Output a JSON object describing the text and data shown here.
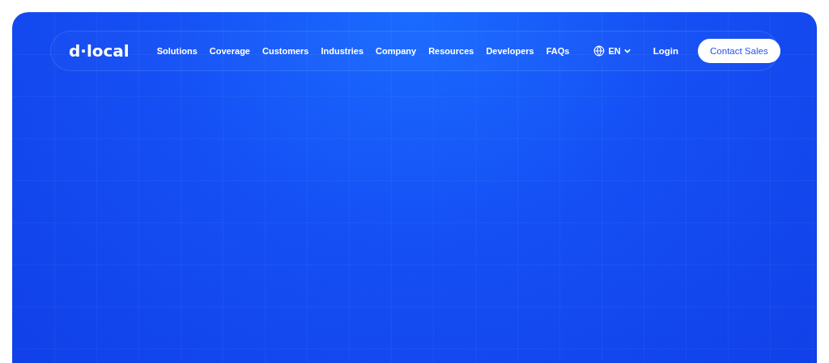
{
  "logo": "d·local",
  "nav": [
    "Solutions",
    "Coverage",
    "Customers",
    "Industries",
    "Company",
    "Resources",
    "Developers",
    "FAQs"
  ],
  "language": "EN",
  "login": "Login",
  "cta": "Contact Sales"
}
